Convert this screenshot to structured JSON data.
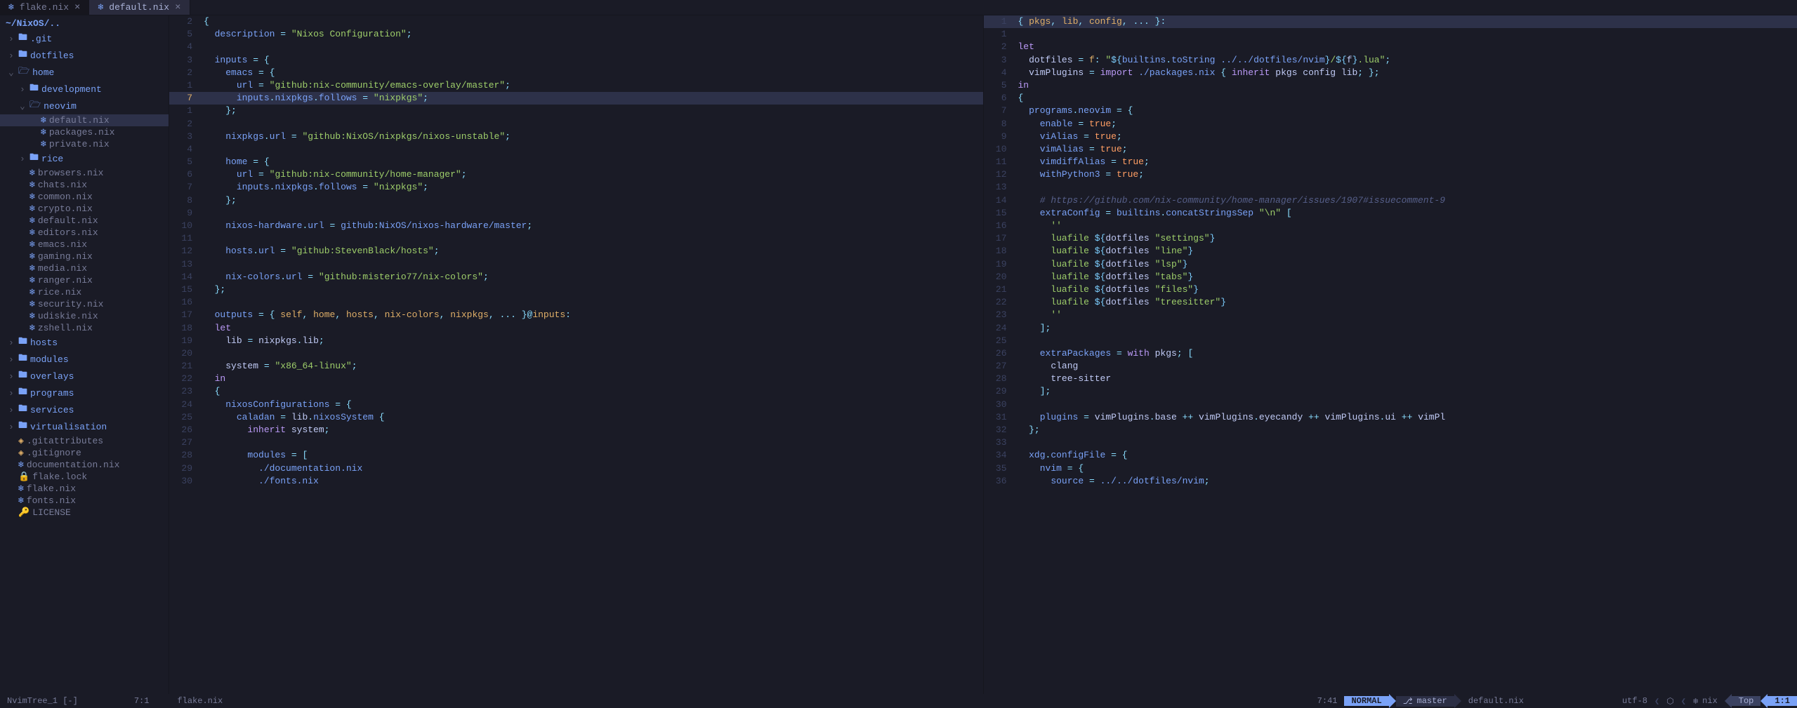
{
  "tabs": [
    {
      "icon": "❄",
      "label": "flake.nix",
      "active": false
    },
    {
      "icon": "❄",
      "label": "default.nix",
      "active": true
    }
  ],
  "sidebar": {
    "path": "~/NixOS/..",
    "items": [
      {
        "depth": 0,
        "arrow": "›",
        "icon": "folder",
        "name": ".git"
      },
      {
        "depth": 0,
        "arrow": "›",
        "icon": "folder",
        "name": "dotfiles"
      },
      {
        "depth": 0,
        "arrow": "⌄",
        "icon": "folder-open",
        "name": "home"
      },
      {
        "depth": 1,
        "arrow": "›",
        "icon": "folder",
        "name": "development"
      },
      {
        "depth": 1,
        "arrow": "⌄",
        "icon": "folder-open",
        "name": "neovim"
      },
      {
        "depth": 2,
        "arrow": "",
        "icon": "nix",
        "name": "default.nix",
        "selected": true
      },
      {
        "depth": 2,
        "arrow": "",
        "icon": "nix",
        "name": "packages.nix"
      },
      {
        "depth": 2,
        "arrow": "",
        "icon": "nix",
        "name": "private.nix"
      },
      {
        "depth": 1,
        "arrow": "›",
        "icon": "folder",
        "name": "rice"
      },
      {
        "depth": 1,
        "arrow": "",
        "icon": "nix",
        "name": "browsers.nix"
      },
      {
        "depth": 1,
        "arrow": "",
        "icon": "nix",
        "name": "chats.nix"
      },
      {
        "depth": 1,
        "arrow": "",
        "icon": "nix",
        "name": "common.nix"
      },
      {
        "depth": 1,
        "arrow": "",
        "icon": "nix",
        "name": "crypto.nix"
      },
      {
        "depth": 1,
        "arrow": "",
        "icon": "nix",
        "name": "default.nix"
      },
      {
        "depth": 1,
        "arrow": "",
        "icon": "nix",
        "name": "editors.nix"
      },
      {
        "depth": 1,
        "arrow": "",
        "icon": "nix",
        "name": "emacs.nix"
      },
      {
        "depth": 1,
        "arrow": "",
        "icon": "nix",
        "name": "gaming.nix"
      },
      {
        "depth": 1,
        "arrow": "",
        "icon": "nix",
        "name": "media.nix"
      },
      {
        "depth": 1,
        "arrow": "",
        "icon": "nix",
        "name": "ranger.nix"
      },
      {
        "depth": 1,
        "arrow": "",
        "icon": "nix",
        "name": "rice.nix"
      },
      {
        "depth": 1,
        "arrow": "",
        "icon": "nix",
        "name": "security.nix"
      },
      {
        "depth": 1,
        "arrow": "",
        "icon": "nix",
        "name": "udiskie.nix"
      },
      {
        "depth": 1,
        "arrow": "",
        "icon": "nix",
        "name": "zshell.nix"
      },
      {
        "depth": 0,
        "arrow": "›",
        "icon": "folder",
        "name": "hosts"
      },
      {
        "depth": 0,
        "arrow": "›",
        "icon": "folder",
        "name": "modules"
      },
      {
        "depth": 0,
        "arrow": "›",
        "icon": "folder",
        "name": "overlays"
      },
      {
        "depth": 0,
        "arrow": "›",
        "icon": "folder",
        "name": "programs"
      },
      {
        "depth": 0,
        "arrow": "›",
        "icon": "folder",
        "name": "services"
      },
      {
        "depth": 0,
        "arrow": "›",
        "icon": "folder",
        "name": "virtualisation"
      },
      {
        "depth": 0,
        "arrow": "",
        "icon": "git",
        "name": ".gitattributes"
      },
      {
        "depth": 0,
        "arrow": "",
        "icon": "git",
        "name": ".gitignore"
      },
      {
        "depth": 0,
        "arrow": "",
        "icon": "nix",
        "name": "documentation.nix"
      },
      {
        "depth": 0,
        "arrow": "",
        "icon": "lock",
        "name": "flake.lock"
      },
      {
        "depth": 0,
        "arrow": "",
        "icon": "nix",
        "name": "flake.nix"
      },
      {
        "depth": 0,
        "arrow": "",
        "icon": "nix",
        "name": "fonts.nix"
      },
      {
        "depth": 0,
        "arrow": "",
        "icon": "key",
        "name": "LICENSE"
      }
    ]
  },
  "pane1": {
    "filename": "flake.nix",
    "active_line": 7,
    "lines": [
      {
        "ln": 2,
        "html": "<span class='punct'>{</span>"
      },
      {
        "ln": 5,
        "html": "  <span class='prop'>description</span> <span class='op'>=</span> <span class='str'>\"Nixos Configuration\"</span><span class='punct'>;</span>"
      },
      {
        "ln": 4,
        "html": ""
      },
      {
        "ln": 3,
        "html": "  <span class='prop'>inputs</span> <span class='op'>=</span> <span class='punct'>{</span>"
      },
      {
        "ln": 2,
        "html": "    <span class='prop'>emacs</span> <span class='op'>=</span> <span class='punct'>{</span>"
      },
      {
        "ln": 1,
        "html": "      <span class='prop'>url</span> <span class='op'>=</span> <span class='str'>\"github:nix-community/emacs-overlay/master\"</span><span class='punct'>;</span>"
      },
      {
        "ln": 7,
        "active": true,
        "html": "      <span class='prop'>inputs</span><span class='punct'>.</span><span class='prop'>nixpkgs</span><span class='punct'>.</span><span class='prop'>follows</span> <span class='op'>=</span> <span class='str'>\"nixpkgs\"</span><span class='punct'>;</span>"
      },
      {
        "ln": 1,
        "html": "    <span class='punct'>};</span>"
      },
      {
        "ln": 2,
        "html": ""
      },
      {
        "ln": 3,
        "html": "    <span class='prop'>nixpkgs</span><span class='punct'>.</span><span class='prop'>url</span> <span class='op'>=</span> <span class='str'>\"github:NixOS/nixpkgs/nixos-unstable\"</span><span class='punct'>;</span>"
      },
      {
        "ln": 4,
        "html": ""
      },
      {
        "ln": 5,
        "html": "    <span class='prop'>home</span> <span class='op'>=</span> <span class='punct'>{</span>"
      },
      {
        "ln": 6,
        "html": "      <span class='prop'>url</span> <span class='op'>=</span> <span class='str'>\"github:nix-community/home-manager\"</span><span class='punct'>;</span>"
      },
      {
        "ln": 7,
        "html": "      <span class='prop'>inputs</span><span class='punct'>.</span><span class='prop'>nixpkgs</span><span class='punct'>.</span><span class='prop'>follows</span> <span class='op'>=</span> <span class='str'>\"nixpkgs\"</span><span class='punct'>;</span>"
      },
      {
        "ln": 8,
        "html": "    <span class='punct'>};</span>"
      },
      {
        "ln": 9,
        "html": ""
      },
      {
        "ln": 10,
        "html": "    <span class='prop'>nixos-hardware</span><span class='punct'>.</span><span class='prop'>url</span> <span class='op'>=</span> <span class='builtin'>github</span><span class='punct'>:</span><span class='builtin'>NixOS/nixos-hardware/master</span><span class='punct'>;</span>"
      },
      {
        "ln": 11,
        "html": ""
      },
      {
        "ln": 12,
        "html": "    <span class='prop'>hosts</span><span class='punct'>.</span><span class='prop'>url</span> <span class='op'>=</span> <span class='str'>\"github:StevenBlack/hosts\"</span><span class='punct'>;</span>"
      },
      {
        "ln": 13,
        "html": ""
      },
      {
        "ln": 14,
        "html": "    <span class='prop'>nix-colors</span><span class='punct'>.</span><span class='prop'>url</span> <span class='op'>=</span> <span class='str'>\"github:misterio77/nix-colors\"</span><span class='punct'>;</span>"
      },
      {
        "ln": 15,
        "html": "  <span class='punct'>};</span>"
      },
      {
        "ln": 16,
        "html": ""
      },
      {
        "ln": 17,
        "html": "  <span class='prop'>outputs</span> <span class='op'>=</span> <span class='punct'>{</span> <span class='param'>self</span><span class='punct'>,</span> <span class='param'>home</span><span class='punct'>,</span> <span class='param'>hosts</span><span class='punct'>,</span> <span class='param'>nix-colors</span><span class='punct'>,</span> <span class='param'>nixpkgs</span><span class='punct'>,</span> <span class='punct'>...</span> <span class='punct'>}</span><span class='op'>@</span><span class='param'>inputs</span><span class='punct'>:</span>"
      },
      {
        "ln": 18,
        "html": "  <span class='kw'>let</span>"
      },
      {
        "ln": 19,
        "html": "    <span class='ident'>lib</span> <span class='op'>=</span> <span class='ident'>nixpkgs</span><span class='punct'>.</span><span class='ident'>lib</span><span class='punct'>;</span>"
      },
      {
        "ln": 20,
        "html": ""
      },
      {
        "ln": 21,
        "html": "    <span class='ident'>system</span> <span class='op'>=</span> <span class='str'>\"x86_64-linux\"</span><span class='punct'>;</span>"
      },
      {
        "ln": 22,
        "html": "  <span class='kw'>in</span>"
      },
      {
        "ln": 23,
        "html": "  <span class='punct'>{</span>"
      },
      {
        "ln": 24,
        "html": "    <span class='prop'>nixosConfigurations</span> <span class='op'>=</span> <span class='punct'>{</span>"
      },
      {
        "ln": 25,
        "html": "      <span class='prop'>caladan</span> <span class='op'>=</span> <span class='ident'>lib</span><span class='punct'>.</span><span class='func'>nixosSystem</span> <span class='punct'>{</span>"
      },
      {
        "ln": 26,
        "html": "        <span class='kw'>inherit</span> <span class='ident'>system</span><span class='punct'>;</span>"
      },
      {
        "ln": 27,
        "html": ""
      },
      {
        "ln": 28,
        "html": "        <span class='prop'>modules</span> <span class='op'>=</span> <span class='punct'>[</span>"
      },
      {
        "ln": 29,
        "html": "          <span class='builtin'>./documentation.nix</span>"
      },
      {
        "ln": 30,
        "html": "          <span class='builtin'>./fonts.nix</span>"
      }
    ]
  },
  "pane2": {
    "filename": "default.nix",
    "lines": [
      {
        "ln": 1,
        "html": "<span class='punct'>{</span> <span class='param'>pkgs</span><span class='punct'>,</span> <span class='param'>lib</span><span class='punct'>,</span> <span class='param'>config</span><span class='punct'>,</span> <span class='punct'>...</span> <span class='punct'>}:</span>",
        "bg": true
      },
      {
        "ln": 1,
        "html": ""
      },
      {
        "ln": 2,
        "html": "<span class='kw'>let</span>"
      },
      {
        "ln": 3,
        "html": "  <span class='ident'>dotfiles</span> <span class='op'>=</span> <span class='param'>f</span><span class='punct'>:</span> <span class='str'>\"</span><span class='interp'>${</span><span class='builtin'>builtins</span><span class='punct'>.</span><span class='func'>toString</span> <span class='builtin'>../../dotfiles/nvim</span><span class='interp'>}</span><span class='str'>/</span><span class='interp'>${</span><span class='ident'>f</span><span class='interp'>}</span><span class='str'>.lua\"</span><span class='punct'>;</span>"
      },
      {
        "ln": 4,
        "html": "  <span class='ident'>vimPlugins</span> <span class='op'>=</span> <span class='kw'>import</span> <span class='builtin'>./packages.nix</span> <span class='punct'>{</span> <span class='kw'>inherit</span> <span class='ident'>pkgs config lib</span><span class='punct'>;</span> <span class='punct'>};</span>"
      },
      {
        "ln": 5,
        "html": "<span class='kw'>in</span>"
      },
      {
        "ln": 6,
        "html": "<span class='punct'>{</span>"
      },
      {
        "ln": 7,
        "html": "  <span class='prop'>programs</span><span class='punct'>.</span><span class='prop'>neovim</span> <span class='op'>=</span> <span class='punct'>{</span>"
      },
      {
        "ln": 8,
        "html": "    <span class='prop'>enable</span> <span class='op'>=</span> <span class='num'>true</span><span class='punct'>;</span>"
      },
      {
        "ln": 9,
        "html": "    <span class='prop'>viAlias</span> <span class='op'>=</span> <span class='num'>true</span><span class='punct'>;</span>"
      },
      {
        "ln": 10,
        "html": "    <span class='prop'>vimAlias</span> <span class='op'>=</span> <span class='num'>true</span><span class='punct'>;</span>"
      },
      {
        "ln": 11,
        "html": "    <span class='prop'>vimdiffAlias</span> <span class='op'>=</span> <span class='num'>true</span><span class='punct'>;</span>"
      },
      {
        "ln": 12,
        "html": "    <span class='prop'>withPython3</span> <span class='op'>=</span> <span class='num'>true</span><span class='punct'>;</span>"
      },
      {
        "ln": 13,
        "html": ""
      },
      {
        "ln": 14,
        "html": "    <span class='comment'># https://github.com/nix-community/home-manager/issues/1907#issuecomment-9</span>"
      },
      {
        "ln": 15,
        "html": "    <span class='prop'>extraConfig</span> <span class='op'>=</span> <span class='builtin'>builtins</span><span class='punct'>.</span><span class='func'>concatStringsSep</span> <span class='str'>\"\\n\"</span> <span class='punct'>[</span>"
      },
      {
        "ln": 16,
        "html": "      <span class='str'>''</span>"
      },
      {
        "ln": 17,
        "html": "<span class='str'>      luafile </span><span class='interp'>${</span><span class='ident'>dotfiles</span> <span class='str'>\"settings\"</span><span class='interp'>}</span>"
      },
      {
        "ln": 18,
        "html": "<span class='str'>      luafile </span><span class='interp'>${</span><span class='ident'>dotfiles</span> <span class='str'>\"line\"</span><span class='interp'>}</span>"
      },
      {
        "ln": 19,
        "html": "<span class='str'>      luafile </span><span class='interp'>${</span><span class='ident'>dotfiles</span> <span class='str'>\"lsp\"</span><span class='interp'>}</span>"
      },
      {
        "ln": 20,
        "html": "<span class='str'>      luafile </span><span class='interp'>${</span><span class='ident'>dotfiles</span> <span class='str'>\"tabs\"</span><span class='interp'>}</span>"
      },
      {
        "ln": 21,
        "html": "<span class='str'>      luafile </span><span class='interp'>${</span><span class='ident'>dotfiles</span> <span class='str'>\"files\"</span><span class='interp'>}</span>"
      },
      {
        "ln": 22,
        "html": "<span class='str'>      luafile </span><span class='interp'>${</span><span class='ident'>dotfiles</span> <span class='str'>\"treesitter\"</span><span class='interp'>}</span>"
      },
      {
        "ln": 23,
        "html": "      <span class='str'>''</span>"
      },
      {
        "ln": 24,
        "html": "    <span class='punct'>];</span>"
      },
      {
        "ln": 25,
        "html": ""
      },
      {
        "ln": 26,
        "html": "    <span class='prop'>extraPackages</span> <span class='op'>=</span> <span class='kw'>with</span> <span class='ident'>pkgs</span><span class='punct'>;</span> <span class='punct'>[</span>"
      },
      {
        "ln": 27,
        "html": "      <span class='ident'>clang</span>"
      },
      {
        "ln": 28,
        "html": "      <span class='ident'>tree-sitter</span>"
      },
      {
        "ln": 29,
        "html": "    <span class='punct'>];</span>"
      },
      {
        "ln": 30,
        "html": ""
      },
      {
        "ln": 31,
        "html": "    <span class='prop'>plugins</span> <span class='op'>=</span> <span class='ident'>vimPlugins</span><span class='punct'>.</span><span class='ident'>base</span> <span class='op'>++</span> <span class='ident'>vimPlugins</span><span class='punct'>.</span><span class='ident'>eyecandy</span> <span class='op'>++</span> <span class='ident'>vimPlugins</span><span class='punct'>.</span><span class='ident'>ui</span> <span class='op'>++</span> <span class='ident'>vimPl</span>"
      },
      {
        "ln": 32,
        "html": "  <span class='punct'>};</span>"
      },
      {
        "ln": 33,
        "html": ""
      },
      {
        "ln": 34,
        "html": "  <span class='prop'>xdg</span><span class='punct'>.</span><span class='prop'>configFile</span> <span class='op'>=</span> <span class='punct'>{</span>"
      },
      {
        "ln": 35,
        "html": "    <span class='prop'>nvim</span> <span class='op'>=</span> <span class='punct'>{</span>"
      },
      {
        "ln": 36,
        "html": "      <span class='prop'>source</span> <span class='op'>=</span> <span class='builtin'>../../dotfiles/nvim</span><span class='punct'>;</span>"
      }
    ]
  },
  "status": {
    "left_tree": "NvimTree_1 [-]",
    "left_pos": "7:1",
    "left_file": "flake.nix",
    "left_cursor": "7:41",
    "mode": "NORMAL",
    "branch": "master",
    "right_file": "default.nix",
    "encoding": "utf-8",
    "filetype": "nix",
    "scroll": "Top",
    "position": "1:1"
  }
}
